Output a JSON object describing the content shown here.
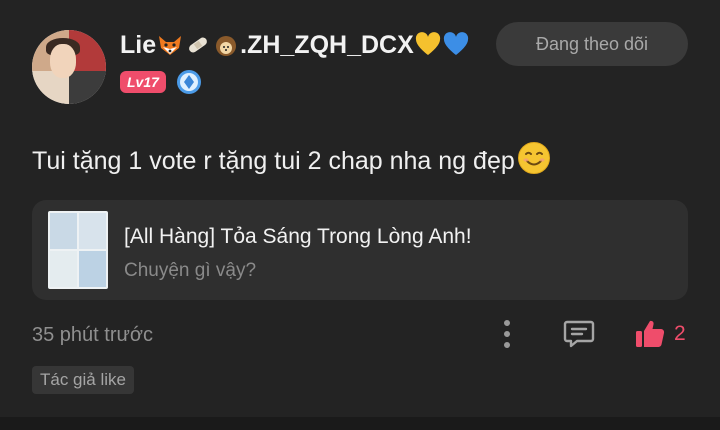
{
  "user": {
    "name_start": "Lie",
    "name_end": ".ZH_ZQH_DCX",
    "level": "Lv17",
    "follow_label": "Đang theo dõi",
    "emojis": [
      "fox-icon",
      "bandage-icon",
      "hedgehog-icon",
      "yellow-heart-icon",
      "blue-heart-icon"
    ]
  },
  "comment": {
    "text": "Tui tặng 1 vote r tặng tui 2 chap nha ng đẹp",
    "emoji": "smiling-face-icon"
  },
  "chapter": {
    "title": "[All Hàng] Tỏa Sáng Trong Lòng Anh!",
    "subtitle": "Chuyện gì vậy?"
  },
  "meta": {
    "timestamp": "35 phút trước",
    "like_count": "2",
    "author_tag": "Tác giả like"
  },
  "colors": {
    "background": "#232323",
    "accent": "#ef4d6b",
    "card": "#2f2f2f"
  }
}
